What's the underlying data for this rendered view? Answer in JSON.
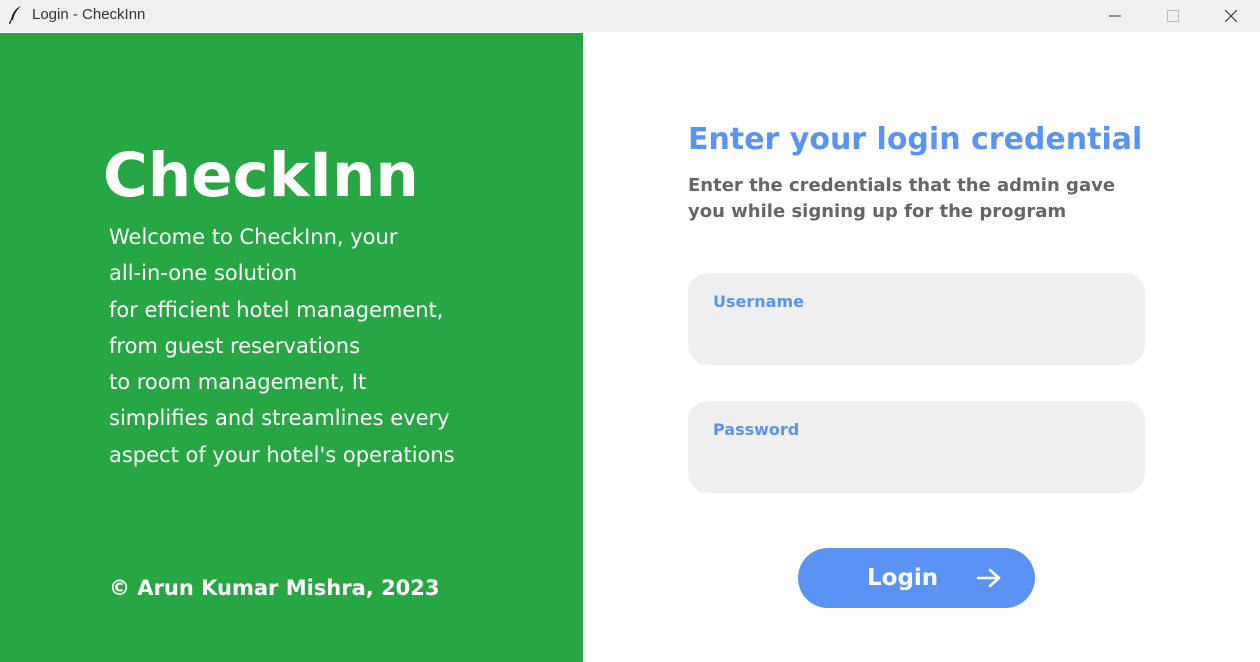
{
  "window": {
    "title": "Login - CheckInn",
    "icon": "feather-icon",
    "controls": [
      "minimize-icon",
      "maximize-icon",
      "close-icon"
    ]
  },
  "left_panel": {
    "background_color": "#27a744",
    "brand": "CheckInn",
    "welcome_lines": [
      "Welcome to CheckInn, your",
      "all-in-one solution",
      "for efficient hotel management,",
      "from guest reservations",
      "to room management, It",
      "simplifies and streamlines every",
      "aspect of your hotel's operations"
    ],
    "copyright": "© Arun Kumar Mishra, 2023"
  },
  "right_panel": {
    "heading": "Enter your login credential",
    "subheading_lines": [
      "Enter the credentials that the admin gave",
      "you while signing up for the program"
    ],
    "username": {
      "label": "Username",
      "value": ""
    },
    "password": {
      "label": "Password",
      "value": ""
    },
    "login_button": {
      "label": "Login",
      "icon": "arrow-right-icon"
    },
    "accent_color": "#5b93f5",
    "field_background": "#efefef"
  }
}
